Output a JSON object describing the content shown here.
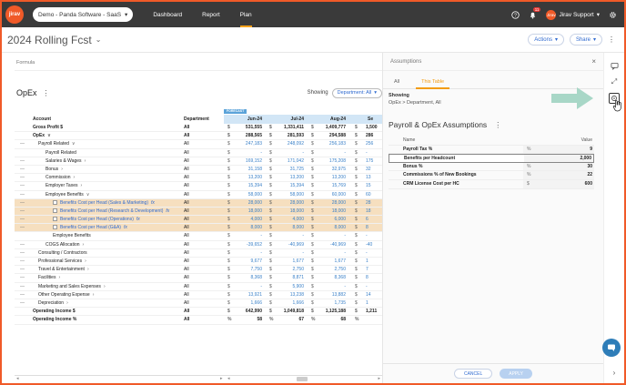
{
  "topbar": {
    "logo_text": "jirav",
    "company": "Demo - Panda Software - SaaS",
    "nav": [
      "Dashboard",
      "Report",
      "Plan"
    ],
    "active_nav": "Plan",
    "notifications": "11",
    "user_avatar": "Jirav",
    "user": "Jirav Support"
  },
  "title": {
    "text": "2024 Rolling Fcst",
    "actions_label": "Actions",
    "share_label": "Share"
  },
  "formula_label": "Formula",
  "opex": {
    "title": "OpEx",
    "showing_label": "Showing",
    "department": "Department: All"
  },
  "grid": {
    "col_account": "Account",
    "col_department": "Department",
    "forecast_tag": "FORECAST",
    "months": [
      "Jun-24",
      "Jul-24",
      "Aug-24",
      "Se"
    ],
    "rows": [
      {
        "account": "Gross Profit $",
        "indent": 0,
        "bold": true,
        "dash": "",
        "dept": "All",
        "cur": "$",
        "vals": [
          "531,555",
          "1,331,411",
          "1,409,777",
          "1,500"
        ]
      },
      {
        "account": "OpEx",
        "indent": 0,
        "bold": true,
        "dash": "",
        "chev": "∨",
        "dept": "All",
        "cur": "$",
        "vals": [
          "288,565",
          "281,593",
          "294,588",
          "286"
        ]
      },
      {
        "account": "Payroll Related",
        "indent": 1,
        "dash": "—",
        "chev": "∨",
        "dept": "All",
        "cur": "$",
        "vals": [
          "247,183",
          "248,092",
          "256,183",
          "256"
        ]
      },
      {
        "account": "Payroll Related",
        "indent": 2,
        "dash": "",
        "dept": "All",
        "cur": "$",
        "vals": [
          "-",
          "-",
          "-",
          "-"
        ]
      },
      {
        "account": "Salaries & Wages",
        "indent": 2,
        "dash": "—",
        "chev": "›",
        "dept": "All",
        "cur": "$",
        "vals": [
          "169,152",
          "171,042",
          "175,208",
          "175"
        ]
      },
      {
        "account": "Bonus",
        "indent": 2,
        "dash": "—",
        "chev": "›",
        "dept": "All",
        "cur": "$",
        "vals": [
          "31,158",
          "31,725",
          "32,975",
          "32"
        ]
      },
      {
        "account": "Commission",
        "indent": 2,
        "dash": "—",
        "chev": "›",
        "dept": "All",
        "cur": "$",
        "vals": [
          "13,200",
          "13,200",
          "13,200",
          "13"
        ]
      },
      {
        "account": "Employer Taxes",
        "indent": 2,
        "dash": "—",
        "chev": "›",
        "dept": "All",
        "cur": "$",
        "vals": [
          "15,394",
          "15,394",
          "15,769",
          "15"
        ]
      },
      {
        "account": "Employee Benefits",
        "indent": 2,
        "dash": "—",
        "chev": "∨",
        "dept": "All",
        "cur": "$",
        "vals": [
          "58,000",
          "58,000",
          "60,000",
          "60"
        ]
      },
      {
        "account": "Benefits Cost per Head (Sales & Marketing)",
        "indent": 3,
        "dash": "—",
        "check": true,
        "fx": true,
        "hl": true,
        "dept": "All",
        "cur": "$",
        "vals": [
          "28,000",
          "28,000",
          "28,000",
          "28"
        ]
      },
      {
        "account": "Benefits Cost per Head (Research & Development)",
        "indent": 3,
        "dash": "—",
        "check": true,
        "fx": true,
        "hl": true,
        "dept": "All",
        "cur": "$",
        "vals": [
          "18,000",
          "18,000",
          "18,000",
          "18"
        ]
      },
      {
        "account": "Benefits Cost per Head (Operations)",
        "indent": 3,
        "dash": "—",
        "check": true,
        "fx": true,
        "hl": true,
        "dept": "All",
        "cur": "$",
        "vals": [
          "4,000",
          "4,000",
          "6,000",
          "6"
        ]
      },
      {
        "account": "Benefits Cost per Head (G&A)",
        "indent": 3,
        "dash": "—",
        "check": true,
        "fx": true,
        "hl": true,
        "dept": "All",
        "cur": "$",
        "vals": [
          "8,000",
          "8,000",
          "8,000",
          "8"
        ]
      },
      {
        "account": "Employee Benefits",
        "indent": 3,
        "dash": "",
        "dept": "All",
        "cur": "$",
        "vals": [
          "-",
          "-",
          "-",
          "-"
        ]
      },
      {
        "account": "COGS Allocation",
        "indent": 2,
        "dash": "—",
        "chev": "›",
        "dept": "All",
        "cur": "$",
        "vals": [
          "-39,652",
          "-40,969",
          "-40,969",
          "-40"
        ]
      },
      {
        "account": "Consulting / Contractors",
        "indent": 1,
        "dash": "—",
        "dept": "All",
        "cur": "$",
        "vals": [
          "-",
          "-",
          "-",
          "-"
        ]
      },
      {
        "account": "Professional Services",
        "indent": 1,
        "dash": "—",
        "chev": "›",
        "dept": "All",
        "cur": "$",
        "vals": [
          "9,677",
          "1,677",
          "1,677",
          "1"
        ]
      },
      {
        "account": "Travel & Entertainment",
        "indent": 1,
        "dash": "—",
        "chev": "›",
        "dept": "All",
        "cur": "$",
        "vals": [
          "7,750",
          "2,750",
          "2,750",
          "7"
        ]
      },
      {
        "account": "Facilities",
        "indent": 1,
        "dash": "—",
        "chev": "›",
        "dept": "All",
        "cur": "$",
        "vals": [
          "8,368",
          "8,871",
          "8,368",
          "8"
        ]
      },
      {
        "account": "Marketing and Sales Expenses",
        "indent": 1,
        "dash": "—",
        "chev": "›",
        "dept": "All",
        "cur": "$",
        "vals": [
          "-",
          "5,900",
          "-",
          "-"
        ]
      },
      {
        "account": "Other Operating Expense",
        "indent": 1,
        "dash": "—",
        "chev": "›",
        "dept": "All",
        "cur": "$",
        "vals": [
          "13,921",
          "13,238",
          "13,882",
          "14"
        ]
      },
      {
        "account": "Depreciation",
        "indent": 1,
        "dash": "—",
        "chev": "›",
        "dept": "All",
        "cur": "$",
        "vals": [
          "1,666",
          "1,666",
          "1,735",
          "1"
        ]
      },
      {
        "account": "Operating Income $",
        "indent": 0,
        "bold": true,
        "dash": "",
        "dept": "All",
        "cur": "$",
        "vals": [
          "642,990",
          "1,049,818",
          "1,125,188",
          "1,211"
        ]
      },
      {
        "account": "Operating Income %",
        "indent": 0,
        "bold": true,
        "dash": "",
        "dept": "All",
        "cur": "%",
        "vals": [
          "58",
          "67",
          "68",
          ""
        ]
      }
    ]
  },
  "assumptions": {
    "header": "Assumptions",
    "tabs": [
      "All",
      "This Table"
    ],
    "active_tab": "This Table",
    "showing_label": "Showing",
    "showing_path": "OpEx > Department, All",
    "section_title": "Payroll & OpEx Assumptions",
    "col_name": "Name",
    "col_value": "Value",
    "items": [
      {
        "name": "Payroll Tax %",
        "unit": "%",
        "value": "9"
      },
      {
        "name": "Benefits per Headcount",
        "unit": "",
        "value": "2,000",
        "selected": true
      },
      {
        "name": "Bonus %",
        "unit": "%",
        "value": "30"
      },
      {
        "name": "Commissions % of New Bookings",
        "unit": "%",
        "value": "22"
      },
      {
        "name": "CRM License Cost per HC",
        "unit": "$",
        "value": "600"
      }
    ],
    "cancel_label": "CANCEL",
    "apply_label": "APPLY"
  },
  "colors": {
    "brand": "#f05a28",
    "accent": "#2f6ad0",
    "highlight_row": "#f6dfbf",
    "callout_arrow": "#9fd3c1"
  }
}
